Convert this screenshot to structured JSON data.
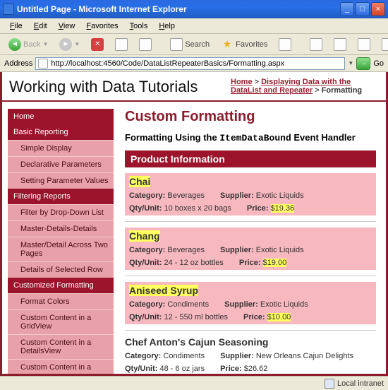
{
  "window": {
    "title": "Untitled Page - Microsoft Internet Explorer"
  },
  "menus": [
    "File",
    "Edit",
    "View",
    "Favorites",
    "Tools",
    "Help"
  ],
  "toolbar": {
    "back": "Back",
    "search": "Search",
    "favorites": "Favorites"
  },
  "address": {
    "label": "Address",
    "url": "http://localhost:4560/Code/DataListRepeaterBasics/Formatting.aspx",
    "go": "Go"
  },
  "header": {
    "title": "Working with Data Tutorials"
  },
  "breadcrumb": {
    "home": "Home",
    "mid": "Displaying Data with the DataList and Repeater",
    "current": "Formatting",
    "sep": " > "
  },
  "sidebar": [
    {
      "type": "hdr",
      "label": "Home"
    },
    {
      "type": "hdr",
      "label": "Basic Reporting"
    },
    {
      "type": "it",
      "label": "Simple Display"
    },
    {
      "type": "it",
      "label": "Declarative Parameters"
    },
    {
      "type": "it",
      "label": "Setting Parameter Values"
    },
    {
      "type": "hdr",
      "label": "Filtering Reports"
    },
    {
      "type": "it",
      "label": "Filter by Drop-Down List"
    },
    {
      "type": "it",
      "label": "Master-Details-Details"
    },
    {
      "type": "it",
      "label": "Master/Detail Across Two Pages"
    },
    {
      "type": "it",
      "label": "Details of Selected Row"
    },
    {
      "type": "hdr",
      "label": "Customized Formatting"
    },
    {
      "type": "it",
      "label": "Format Colors"
    },
    {
      "type": "it",
      "label": "Custom Content in a GridView"
    },
    {
      "type": "it",
      "label": "Custom Content in a DetailsView"
    },
    {
      "type": "it",
      "label": "Custom Content in a"
    }
  ],
  "content": {
    "title": "Custom Formatting",
    "subhead_a": "Formatting Using the ",
    "subhead_code": "ItemDataBound",
    "subhead_b": " Event Handler",
    "band": "Product Information",
    "labels": {
      "category": "Category:",
      "supplier": "Supplier:",
      "qty": "Qty/Unit:",
      "price": "Price:"
    },
    "products": [
      {
        "name": "Chai",
        "category": "Beverages",
        "supplier": "Exotic Liquids",
        "qty": "10 boxes x 20 bags",
        "price": "$19.36",
        "highlight": true
      },
      {
        "name": "Chang",
        "category": "Beverages",
        "supplier": "Exotic Liquids",
        "qty": "24 - 12 oz bottles",
        "price": "$19.00",
        "highlight": true
      },
      {
        "name": "Aniseed Syrup",
        "category": "Condiments",
        "supplier": "Exotic Liquids",
        "qty": "12 - 550 ml bottles",
        "price": "$10.00",
        "highlight": true
      },
      {
        "name": "Chef Anton's Cajun Seasoning",
        "category": "Condiments",
        "supplier": "New Orleans Cajun Delights",
        "qty": "48 - 6 oz jars",
        "price": "$26.62",
        "highlight": false
      }
    ]
  },
  "status": {
    "zone": "Local intranet"
  }
}
